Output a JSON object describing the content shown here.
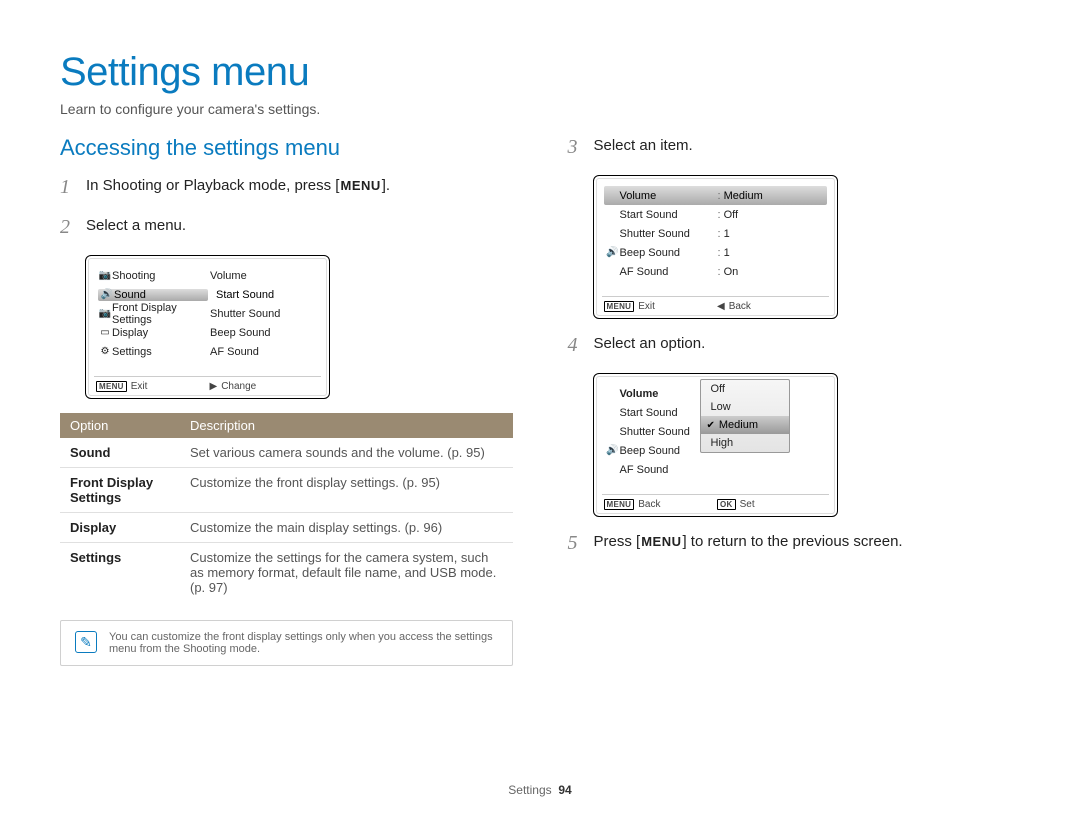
{
  "title": "Settings menu",
  "subtitle": "Learn to configure your camera's settings.",
  "section_title": "Accessing the settings menu",
  "steps": {
    "s1": {
      "num": "1",
      "pre": "In Shooting or Playback mode, press [",
      "badge": "MENU",
      "post": "]."
    },
    "s2": {
      "num": "2",
      "text": "Select a menu."
    },
    "s3": {
      "num": "3",
      "text": "Select an item."
    },
    "s4": {
      "num": "4",
      "text": "Select an option."
    },
    "s5": {
      "num": "5",
      "pre": "Press [",
      "badge": "MENU",
      "post": "] to return to the previous screen."
    }
  },
  "lcd1": {
    "left": [
      {
        "icon": "📷",
        "name": "Shooting"
      },
      {
        "icon": "🔊",
        "name": "Sound",
        "sel": true
      },
      {
        "icon": "📷",
        "name": "Front Display Settings"
      },
      {
        "icon": "▭",
        "name": "Display"
      },
      {
        "icon": "⚙",
        "name": "Settings"
      }
    ],
    "right": [
      "Volume",
      "Start Sound",
      "Shutter Sound",
      "Beep Sound",
      "AF Sound"
    ],
    "foot_left_tag": "MENU",
    "foot_left": "Exit",
    "foot_right_tag": "▶",
    "foot_right": "Change"
  },
  "lcd2": {
    "rows": [
      {
        "icon": "",
        "name": "Volume",
        "val": "Medium",
        "sel": true
      },
      {
        "icon": "",
        "name": "Start Sound",
        "val": "Off"
      },
      {
        "icon": "",
        "name": "Shutter Sound",
        "val": "1"
      },
      {
        "icon": "🔊",
        "name": "Beep Sound",
        "val": "1"
      },
      {
        "icon": "",
        "name": "AF Sound",
        "val": "On"
      }
    ],
    "foot_left_tag": "MENU",
    "foot_left": "Exit",
    "foot_right_tag": "◀",
    "foot_right": "Back"
  },
  "lcd3": {
    "rows": [
      {
        "icon": "",
        "name": "Volume",
        "bold": true
      },
      {
        "icon": "",
        "name": "Start Sound"
      },
      {
        "icon": "",
        "name": "Shutter Sound"
      },
      {
        "icon": "🔊",
        "name": "Beep Sound"
      },
      {
        "icon": "",
        "name": "AF Sound"
      }
    ],
    "popup": [
      "Off",
      "Low",
      "Medium",
      "High"
    ],
    "popup_sel": "Medium",
    "foot_left_tag": "MENU",
    "foot_left": "Back",
    "foot_right_tag": "OK",
    "foot_right": "Set"
  },
  "table": {
    "h1": "Option",
    "h2": "Description",
    "rows": [
      {
        "o": "Sound",
        "d": "Set various camera sounds and the volume. (p. 95)"
      },
      {
        "o": "Front Display Settings",
        "d": "Customize the front display settings. (p. 95)"
      },
      {
        "o": "Display",
        "d": "Customize the main display settings. (p. 96)"
      },
      {
        "o": "Settings",
        "d": "Customize the settings for the camera system, such as memory format, default file name, and USB mode. (p. 97)"
      }
    ]
  },
  "note": "You can customize the front display settings only when you access the settings menu from the Shooting mode.",
  "footer": {
    "label": "Settings",
    "page": "94"
  }
}
